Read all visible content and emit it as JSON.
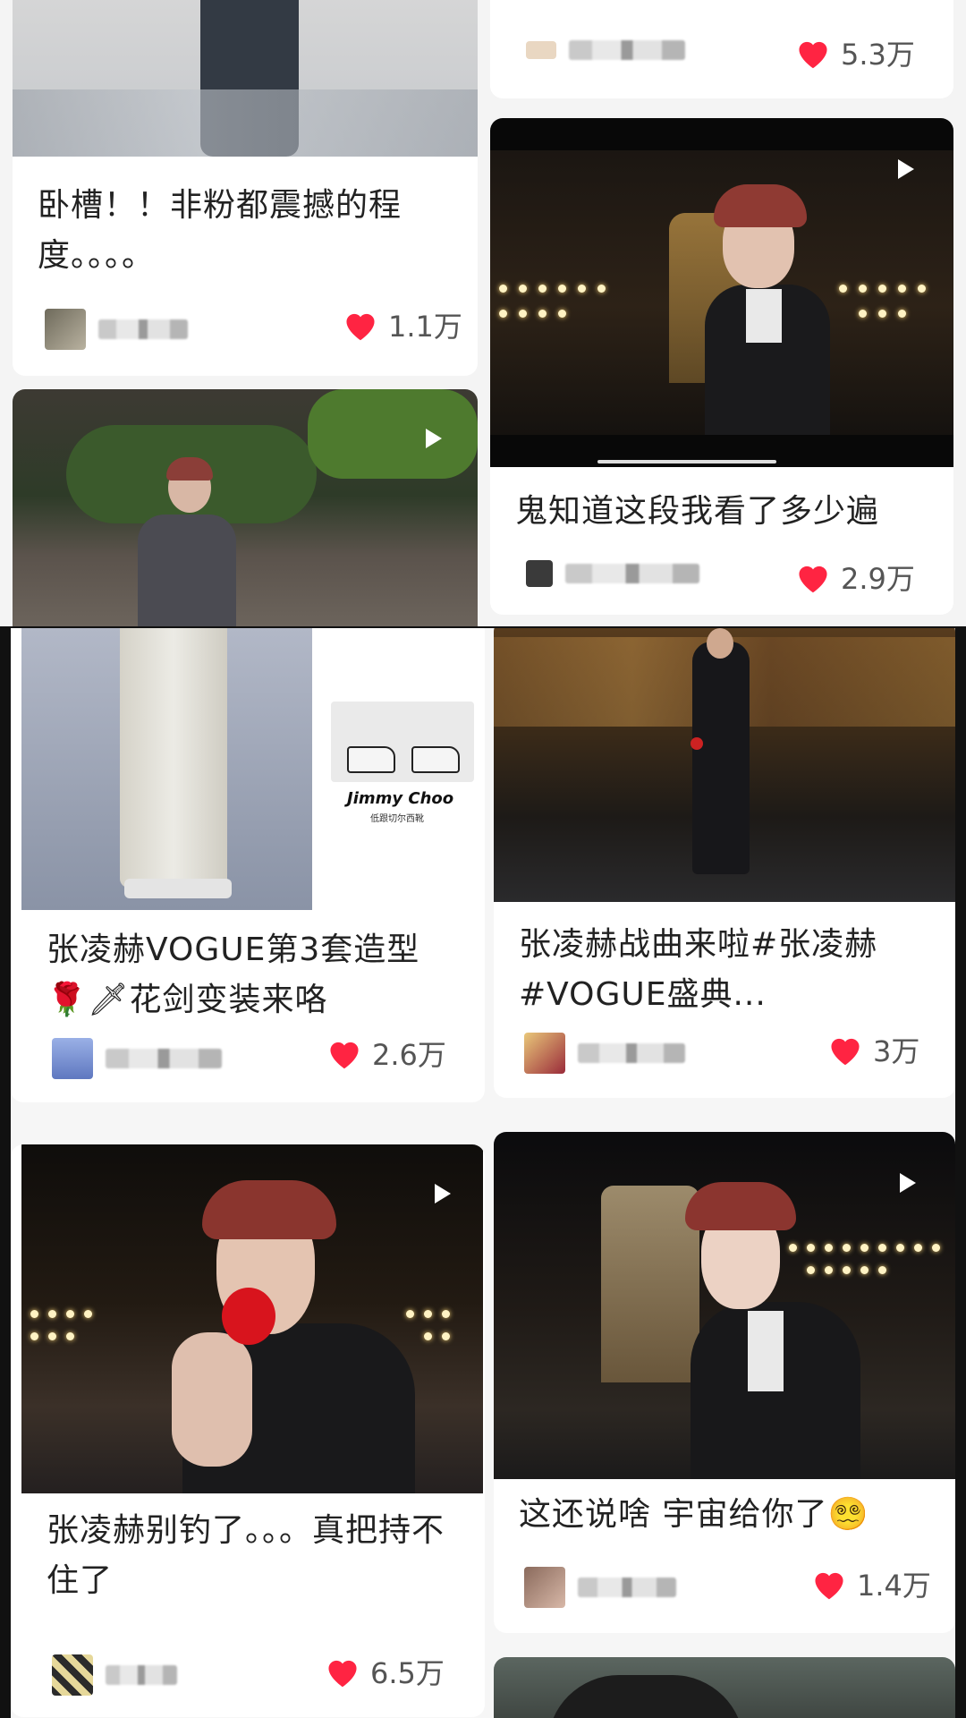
{
  "feed": {
    "top": [
      {
        "title": "卧槽！！非粉都震撼的程度。。。。",
        "likes": "1.1万"
      },
      {
        "title": "",
        "likes": "5.3万"
      },
      {
        "title": "鬼知道这段我看了多少遍",
        "likes": "2.9万"
      }
    ],
    "bottom": [
      {
        "title": "张凌赫VOGUE第3套造型🌹🗡花剑变装来咯",
        "likes": "2.6万",
        "thumb_caption": "Jimmy Choo",
        "thumb_sub": "低跟切尔西靴"
      },
      {
        "title": "张凌赫战曲来啦#张凌赫 #VOGUE盛典...",
        "likes": "3万"
      },
      {
        "title": "张凌赫别钓了。。。真把持不住了",
        "likes": "6.5万"
      },
      {
        "title": "这还说啥 宇宙给你了😵‍💫",
        "likes": "1.4万"
      }
    ]
  },
  "colors": {
    "heart": "#ff2442",
    "card_bg": "#ffffff",
    "page_bg": "#111111"
  },
  "icons": [
    "heart-icon",
    "play-icon"
  ]
}
